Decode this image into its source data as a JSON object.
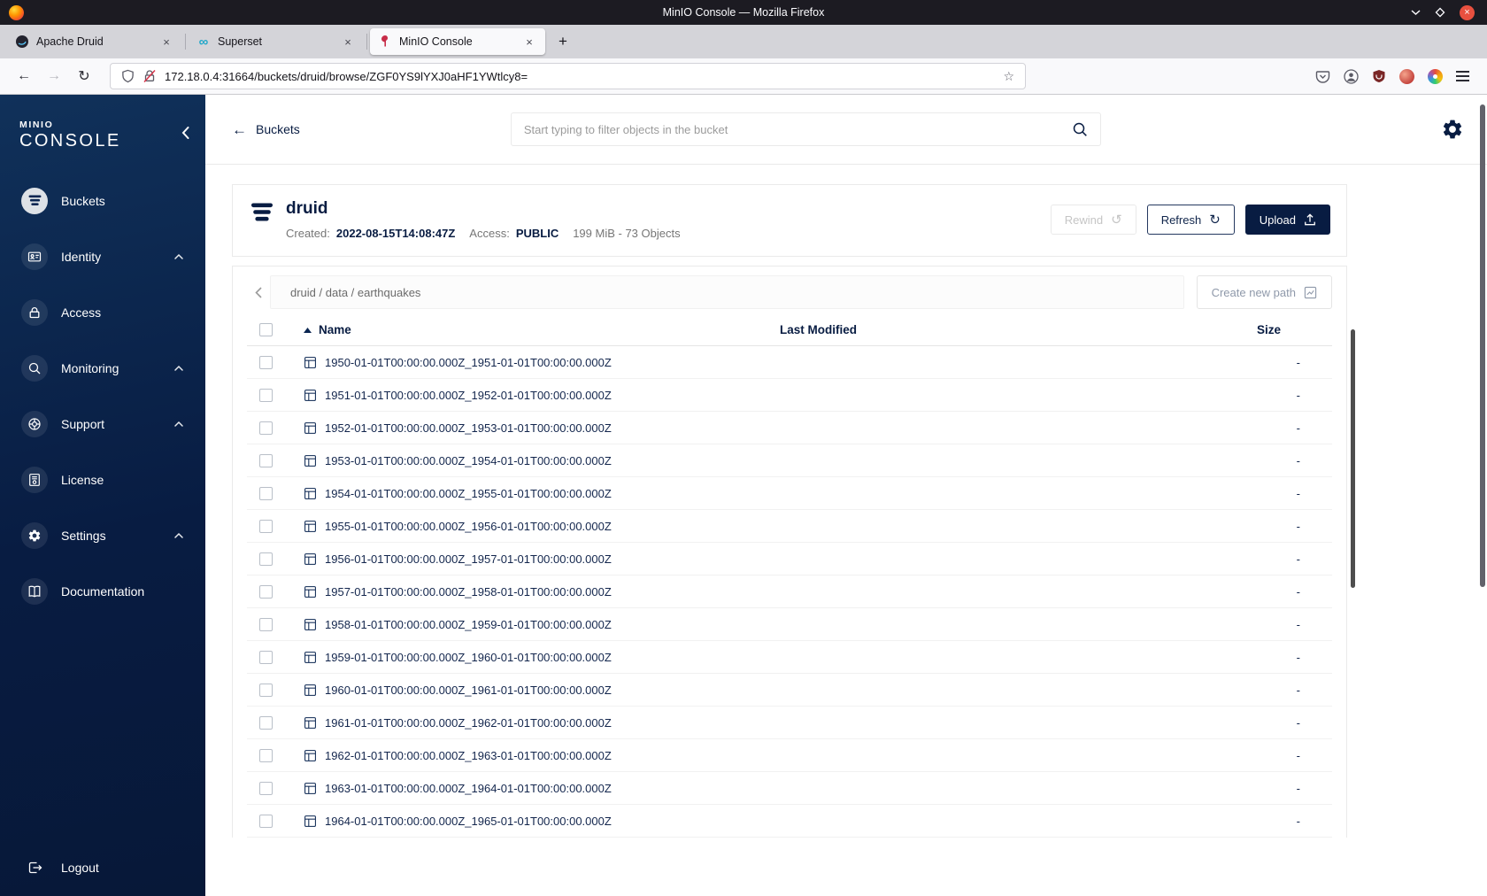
{
  "titlebar": {
    "title": "MinIO Console — Mozilla Firefox"
  },
  "browser": {
    "tabs": [
      {
        "label": "Apache Druid"
      },
      {
        "label": "Superset"
      },
      {
        "label": "MinIO Console"
      }
    ],
    "new_tab_label": "+",
    "url": "172.18.0.4:31664/buckets/druid/browse/ZGF0YS9lYXJ0aHF1YWtlcy8="
  },
  "sidebar": {
    "brand_top": "MINIO",
    "brand_bottom": "CONSOLE",
    "items": [
      {
        "label": "Buckets"
      },
      {
        "label": "Identity"
      },
      {
        "label": "Access"
      },
      {
        "label": "Monitoring"
      },
      {
        "label": "Support"
      },
      {
        "label": "License"
      },
      {
        "label": "Settings"
      },
      {
        "label": "Documentation"
      }
    ],
    "logout_label": "Logout"
  },
  "topbar": {
    "back_label": "Buckets",
    "search_placeholder": "Start typing to filter objects in the bucket"
  },
  "bucket": {
    "name": "druid",
    "created_label": "Created:",
    "created_value": "2022-08-15T14:08:47Z",
    "access_label": "Access:",
    "access_value": "PUBLIC",
    "usage": "199 MiB - 73 Objects",
    "rewind_label": "Rewind",
    "refresh_label": "Refresh",
    "upload_label": "Upload"
  },
  "browse": {
    "path": "druid / data / earthquakes",
    "create_path_label": "Create new path"
  },
  "objects": {
    "headers": {
      "name": "Name",
      "last_modified": "Last Modified",
      "size": "Size"
    },
    "rows": [
      {
        "name": "1950-01-01T00:00:00.000Z_1951-01-01T00:00:00.000Z",
        "last_modified": "",
        "size": "-"
      },
      {
        "name": "1951-01-01T00:00:00.000Z_1952-01-01T00:00:00.000Z",
        "last_modified": "",
        "size": "-"
      },
      {
        "name": "1952-01-01T00:00:00.000Z_1953-01-01T00:00:00.000Z",
        "last_modified": "",
        "size": "-"
      },
      {
        "name": "1953-01-01T00:00:00.000Z_1954-01-01T00:00:00.000Z",
        "last_modified": "",
        "size": "-"
      },
      {
        "name": "1954-01-01T00:00:00.000Z_1955-01-01T00:00:00.000Z",
        "last_modified": "",
        "size": "-"
      },
      {
        "name": "1955-01-01T00:00:00.000Z_1956-01-01T00:00:00.000Z",
        "last_modified": "",
        "size": "-"
      },
      {
        "name": "1956-01-01T00:00:00.000Z_1957-01-01T00:00:00.000Z",
        "last_modified": "",
        "size": "-"
      },
      {
        "name": "1957-01-01T00:00:00.000Z_1958-01-01T00:00:00.000Z",
        "last_modified": "",
        "size": "-"
      },
      {
        "name": "1958-01-01T00:00:00.000Z_1959-01-01T00:00:00.000Z",
        "last_modified": "",
        "size": "-"
      },
      {
        "name": "1959-01-01T00:00:00.000Z_1960-01-01T00:00:00.000Z",
        "last_modified": "",
        "size": "-"
      },
      {
        "name": "1960-01-01T00:00:00.000Z_1961-01-01T00:00:00.000Z",
        "last_modified": "",
        "size": "-"
      },
      {
        "name": "1961-01-01T00:00:00.000Z_1962-01-01T00:00:00.000Z",
        "last_modified": "",
        "size": "-"
      },
      {
        "name": "1962-01-01T00:00:00.000Z_1963-01-01T00:00:00.000Z",
        "last_modified": "",
        "size": "-"
      },
      {
        "name": "1963-01-01T00:00:00.000Z_1964-01-01T00:00:00.000Z",
        "last_modified": "",
        "size": "-"
      },
      {
        "name": "1964-01-01T00:00:00.000Z_1965-01-01T00:00:00.000Z",
        "last_modified": "",
        "size": "-"
      }
    ]
  },
  "colors": {
    "brand_navy": "#081C42",
    "brand_red": "#C72C48",
    "superset_teal": "#20a7c9"
  }
}
